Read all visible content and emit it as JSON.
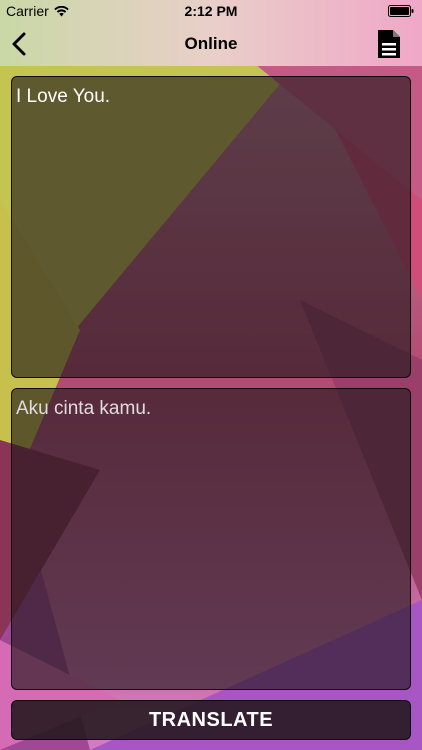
{
  "status_bar": {
    "carrier": "Carrier",
    "time": "2:12 PM",
    "wifi_icon": "wifi-icon",
    "battery_icon": "battery-icon"
  },
  "nav": {
    "title": "Online",
    "back_icon": "chevron-left-icon",
    "document_icon": "document-icon"
  },
  "source": {
    "text": "I Love You."
  },
  "target": {
    "text": "Aku cinta kamu."
  },
  "actions": {
    "translate_label": "TRANSLATE"
  },
  "colors": {
    "panel_background": "#1e1618",
    "text": "#ffffff",
    "navbar_text": "#000000"
  }
}
